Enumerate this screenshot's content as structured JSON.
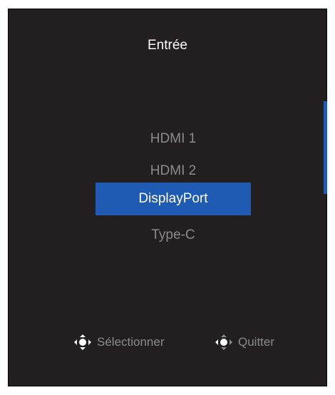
{
  "menu": {
    "title": "Entrée",
    "options": [
      {
        "label": "HDMI 1",
        "selected": false
      },
      {
        "label": "HDMI 2",
        "selected": false
      },
      {
        "label": "DisplayPort",
        "selected": true
      },
      {
        "label": "Type-C",
        "selected": false
      }
    ]
  },
  "footer": {
    "select_icon": "joystick-select-icon",
    "select_label": "Sélectionner",
    "quit_icon": "joystick-left-icon",
    "quit_label": "Quitter"
  },
  "colors": {
    "panel_background": "#231f20",
    "highlight": "#1f5bb3",
    "text_active": "#ffffff",
    "text_inactive": "#8b8b8b"
  }
}
